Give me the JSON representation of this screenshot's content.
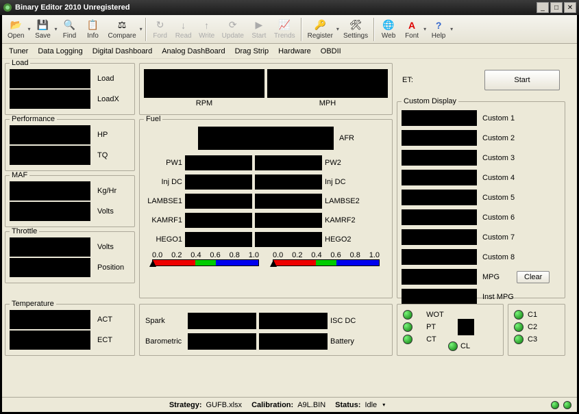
{
  "window": {
    "title": "Binary Editor 2010 Unregistered"
  },
  "toolbar": {
    "open": "Open",
    "save": "Save",
    "find": "Find",
    "info": "Info",
    "compare": "Compare",
    "ford": "Ford",
    "read": "Read",
    "write": "Write",
    "update": "Update",
    "start": "Start",
    "trends": "Trends",
    "register": "Register",
    "settings": "Settings",
    "web": "Web",
    "font": "Font",
    "help": "Help"
  },
  "menubar": {
    "tuner": "Tuner",
    "datalogging": "Data Logging",
    "digitaldash": "Digital Dashboard",
    "analogdash": "Analog DashBoard",
    "dragstrip": "Drag Strip",
    "hardware": "Hardware",
    "obdii": "OBDII"
  },
  "groups": {
    "load": {
      "title": "Load",
      "load": "Load",
      "loadx": "LoadX"
    },
    "performance": {
      "title": "Performance",
      "hp": "HP",
      "tq": "TQ"
    },
    "maf": {
      "title": "MAF",
      "kghr": "Kg/Hr",
      "volts": "Volts"
    },
    "throttle": {
      "title": "Throttle",
      "volts": "Volts",
      "position": "Position"
    },
    "temperature": {
      "title": "Temperature",
      "act": "ACT",
      "ect": "ECT"
    },
    "rpmmph": {
      "rpm": "RPM",
      "mph": "MPH"
    },
    "fuel": {
      "title": "Fuel",
      "afr": "AFR",
      "pw1": "PW1",
      "pw2": "PW2",
      "injdc1": "Inj DC",
      "injdc2": "Inj DC",
      "lambse1": "LAMBSE1",
      "lambse2": "LAMBSE2",
      "kamrf1": "KAMRF1",
      "kamrf2": "KAMRF2",
      "hego1": "HEGO1",
      "hego2": "HEGO2",
      "scale": [
        "0.0",
        "0.2",
        "0.4",
        "0.6",
        "0.8",
        "1.0"
      ]
    },
    "bottom": {
      "spark": "Spark",
      "barometric": "Barometric",
      "iscdc": "ISC DC",
      "battery": "Battery"
    },
    "et": {
      "label": "ET:",
      "start_btn": "Start"
    },
    "custom": {
      "title": "Custom Display",
      "c1": "Custom 1",
      "c2": "Custom 2",
      "c3": "Custom 3",
      "c4": "Custom 4",
      "c5": "Custom 5",
      "c6": "Custom 6",
      "c7": "Custom 7",
      "c8": "Custom 8",
      "mpg": "MPG",
      "instmpg": "Inst MPG",
      "clear_btn": "Clear"
    },
    "indicators": {
      "wot": "WOT",
      "pt": "PT",
      "ct": "CT",
      "cl": "CL",
      "c1": "C1",
      "c2": "C2",
      "c3": "C3"
    }
  },
  "statusbar": {
    "strategy_label": "Strategy:",
    "strategy_val": "GUFB.xlsx",
    "calibration_label": "Calibration:",
    "calibration_val": "A9L.BIN",
    "status_label": "Status:",
    "status_val": "Idle"
  }
}
